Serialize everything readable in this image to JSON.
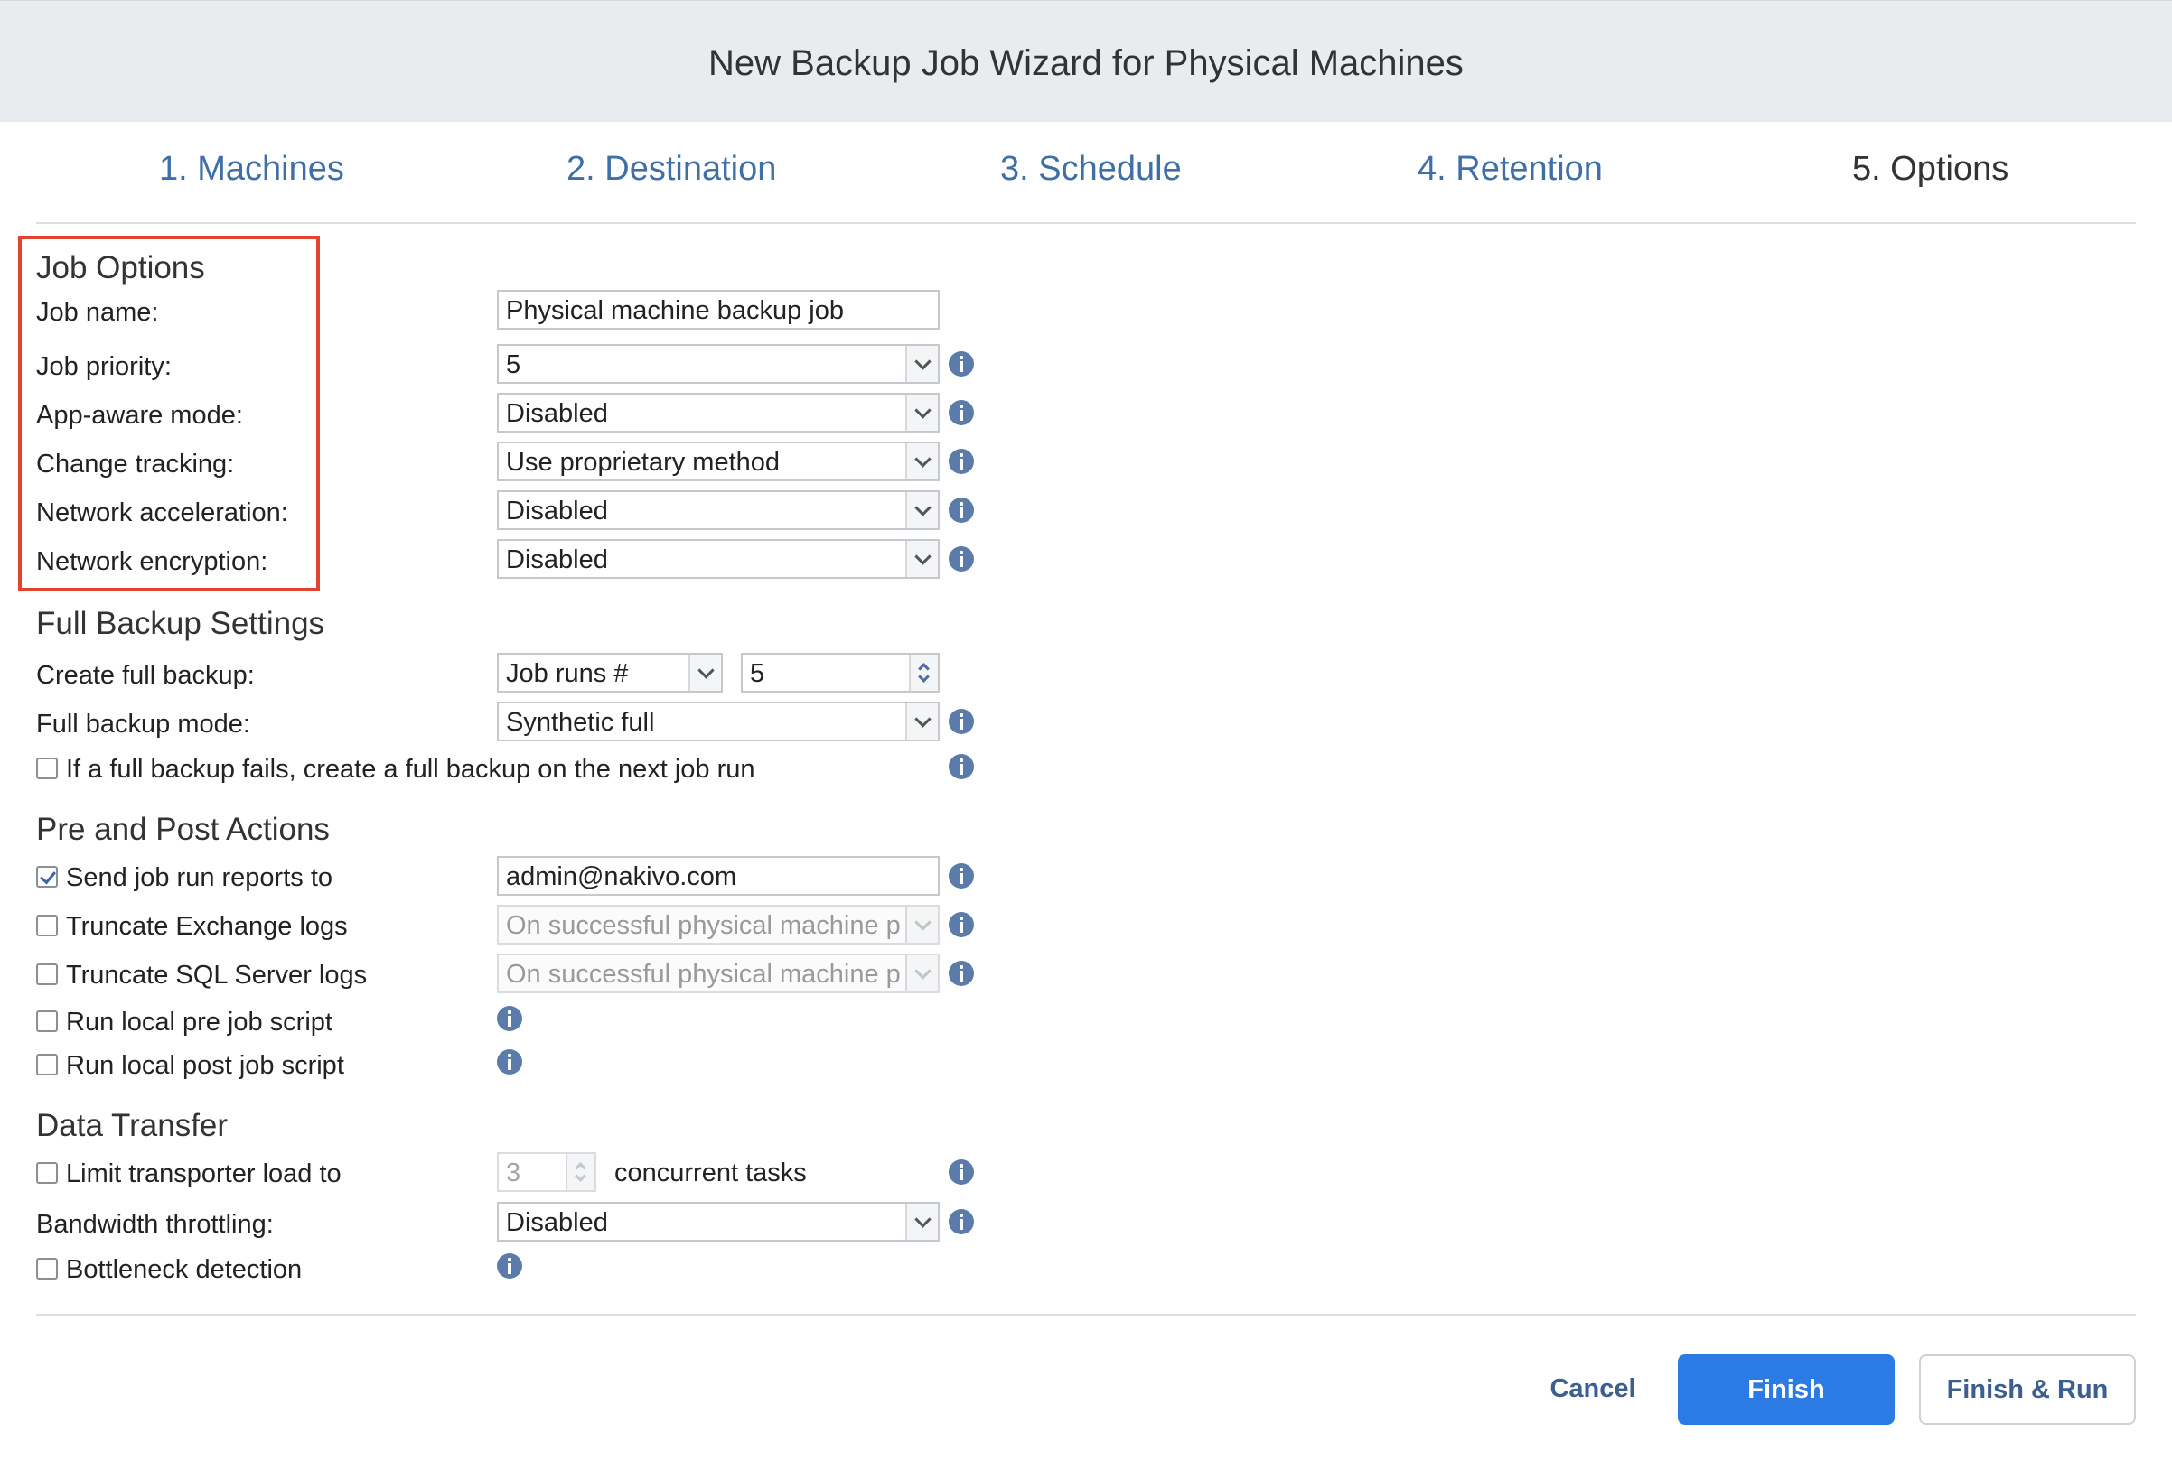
{
  "window": {
    "title": "New Backup Job Wizard for Physical Machines"
  },
  "tabs": [
    {
      "label": "1. Machines"
    },
    {
      "label": "2. Destination"
    },
    {
      "label": "3. Schedule"
    },
    {
      "label": "4. Retention"
    },
    {
      "label": "5. Options"
    }
  ],
  "job_options": {
    "title": "Job Options",
    "job_name_label": "Job name:",
    "job_name_value": "Physical machine backup job",
    "priority_label": "Job priority:",
    "priority_value": "5",
    "app_aware_label": "App-aware mode:",
    "app_aware_value": "Disabled",
    "change_tracking_label": "Change tracking:",
    "change_tracking_value": "Use proprietary method",
    "net_accel_label": "Network acceleration:",
    "net_accel_value": "Disabled",
    "net_encrypt_label": "Network encryption:",
    "net_encrypt_value": "Disabled"
  },
  "full_backup": {
    "title": "Full Backup Settings",
    "create_label": "Create full backup:",
    "create_mode_value": "Job runs #",
    "create_count_value": "5",
    "mode_label": "Full backup mode:",
    "mode_value": "Synthetic full",
    "fail_checkbox_label": "If a full backup fails, create a full backup on the next job run"
  },
  "pre_post": {
    "title": "Pre and Post Actions",
    "reports_label": "Send job run reports to",
    "reports_value": "admin@nakivo.com",
    "exchange_label": "Truncate Exchange logs",
    "exchange_value": "On successful physical machine processing",
    "sql_label": "Truncate SQL Server logs",
    "sql_value": "On successful physical machine processing",
    "pre_script_label": "Run local pre job script",
    "post_script_label": "Run local post job script"
  },
  "data_transfer": {
    "title": "Data Transfer",
    "limit_label": "Limit transporter load to",
    "limit_value": "3",
    "limit_suffix": "concurrent tasks",
    "bandwidth_label": "Bandwidth throttling:",
    "bandwidth_value": "Disabled",
    "bottleneck_label": "Bottleneck detection"
  },
  "footer": {
    "cancel_label": "Cancel",
    "finish_label": "Finish",
    "finish_run_label": "Finish & Run"
  },
  "colors": {
    "accent": "#2c7be5",
    "tab_link": "#3f6fa7",
    "highlight": "#e0452f",
    "info_icon": "#5b7cab"
  }
}
